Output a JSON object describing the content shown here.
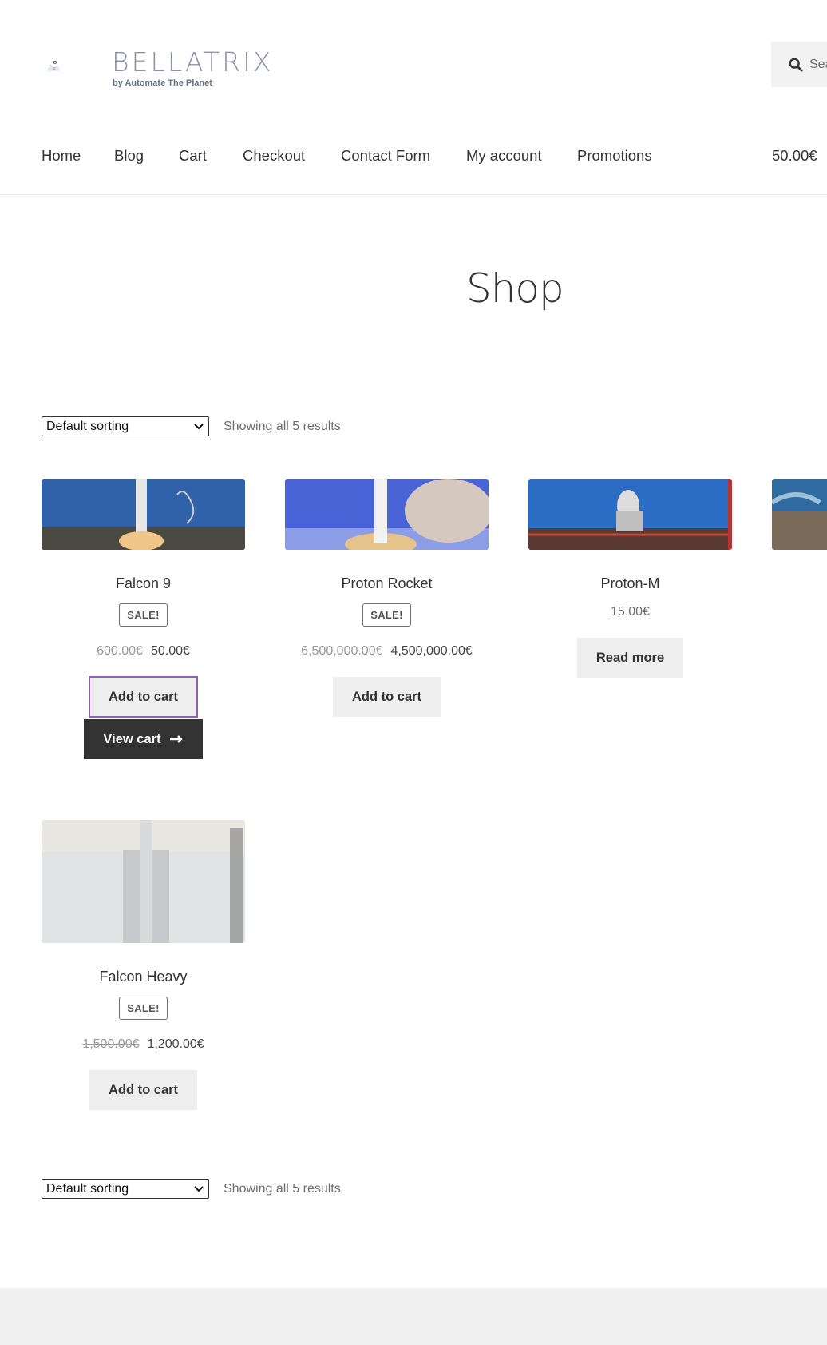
{
  "brand": {
    "name": "BELLATRIX",
    "tagline": "by Automate The Planet",
    "colors": {
      "navy": "#2f3c7e",
      "pink": "#f06b8b",
      "yellow": "#f2c94c",
      "cloud": "#d6ebf5"
    }
  },
  "search": {
    "placeholder": "Sea",
    "icon": "search-icon"
  },
  "nav": {
    "items": [
      {
        "label": "Home"
      },
      {
        "label": "Blog"
      },
      {
        "label": "Cart"
      },
      {
        "label": "Checkout"
      },
      {
        "label": "Contact Form"
      },
      {
        "label": "My account"
      },
      {
        "label": "Promotions"
      }
    ],
    "cart_total": "50.00€"
  },
  "page": {
    "title": "Shop"
  },
  "toolbar": {
    "sort_label": "Default sorting",
    "result_count": "Showing all 5 results"
  },
  "products": [
    {
      "name": "Falcon 9",
      "sale_badge": "SALE!",
      "price_old": "600.00€",
      "price_new": "50.00€",
      "button": "Add to cart",
      "view_cart": "View cart"
    },
    {
      "name": "Proton Rocket",
      "sale_badge": "SALE!",
      "price_old": "6,500,000.00€",
      "price_new": "4,500,000.00€",
      "button": "Add to cart"
    },
    {
      "name": "Proton-M",
      "price": "15.00€",
      "button": "Read more"
    },
    {
      "name": "Falcon Heavy",
      "sale_badge": "SALE!",
      "price_old": "1,500.00€",
      "price_new": "1,200.00€",
      "button": "Add to cart"
    }
  ]
}
